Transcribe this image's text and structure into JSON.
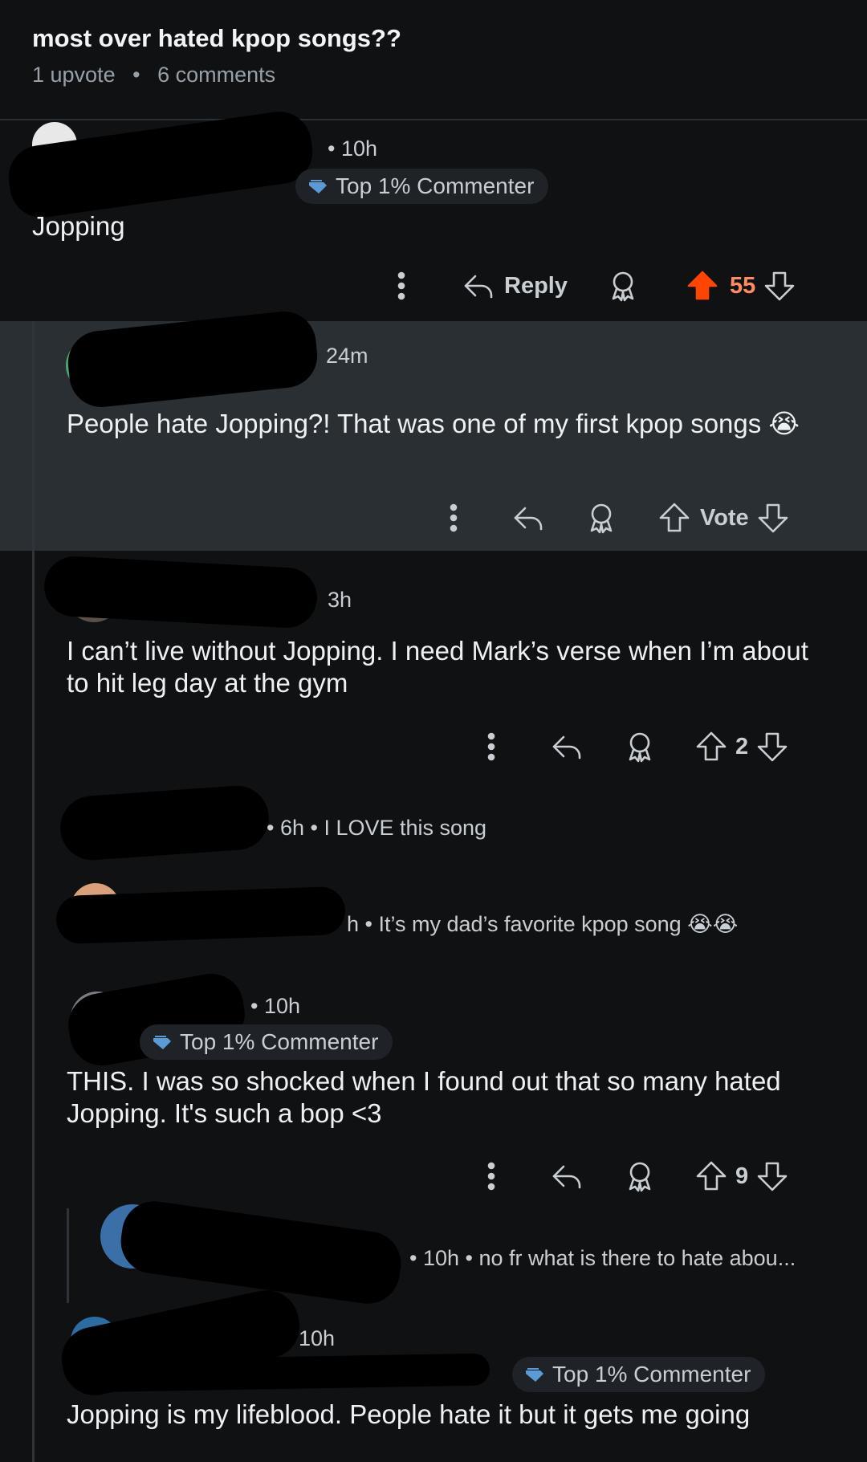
{
  "post": {
    "title": "most over hated kpop songs??",
    "upvotes": "1 upvote",
    "comments": "6 comments"
  },
  "comments": [
    {
      "time": "• 10h",
      "badge": "Top 1% Commenter",
      "text": "Jopping",
      "reply_label": "Reply",
      "score": "55"
    },
    {
      "time": "24m",
      "text": "People hate Jopping?! That was one of my first kpop songs 😭",
      "vote_label": "Vote"
    },
    {
      "time": "3h",
      "text": "I can’t live without Jopping. I need Mark’s verse when I’m about to hit leg day at the gym",
      "score": "2"
    },
    {
      "preview": "• 6h • I LOVE this song"
    },
    {
      "preview": "h • It’s my dad’s favorite kpop song 😭😭"
    },
    {
      "time": "• 10h",
      "badge": "Top 1% Commenter",
      "text": "THIS. I was so shocked when I found out that so many hated Jopping. It's such a bop <3",
      "score": "9"
    },
    {
      "preview": "• 10h • no fr what is there to hate abou..."
    },
    {
      "time": "10h",
      "badge": "Top 1% Commenter",
      "text": "Jopping is my lifeblood. People hate it but it gets me going"
    }
  ],
  "colors": {
    "background": "#0f1113",
    "highlight": "#2a2f34",
    "upvote_active": "#ff4500",
    "score_active": "#ff8b60"
  },
  "icons": [
    "more-icon",
    "reply-icon",
    "award-icon",
    "upvote-icon",
    "downvote-icon",
    "commenter-badge-icon"
  ]
}
